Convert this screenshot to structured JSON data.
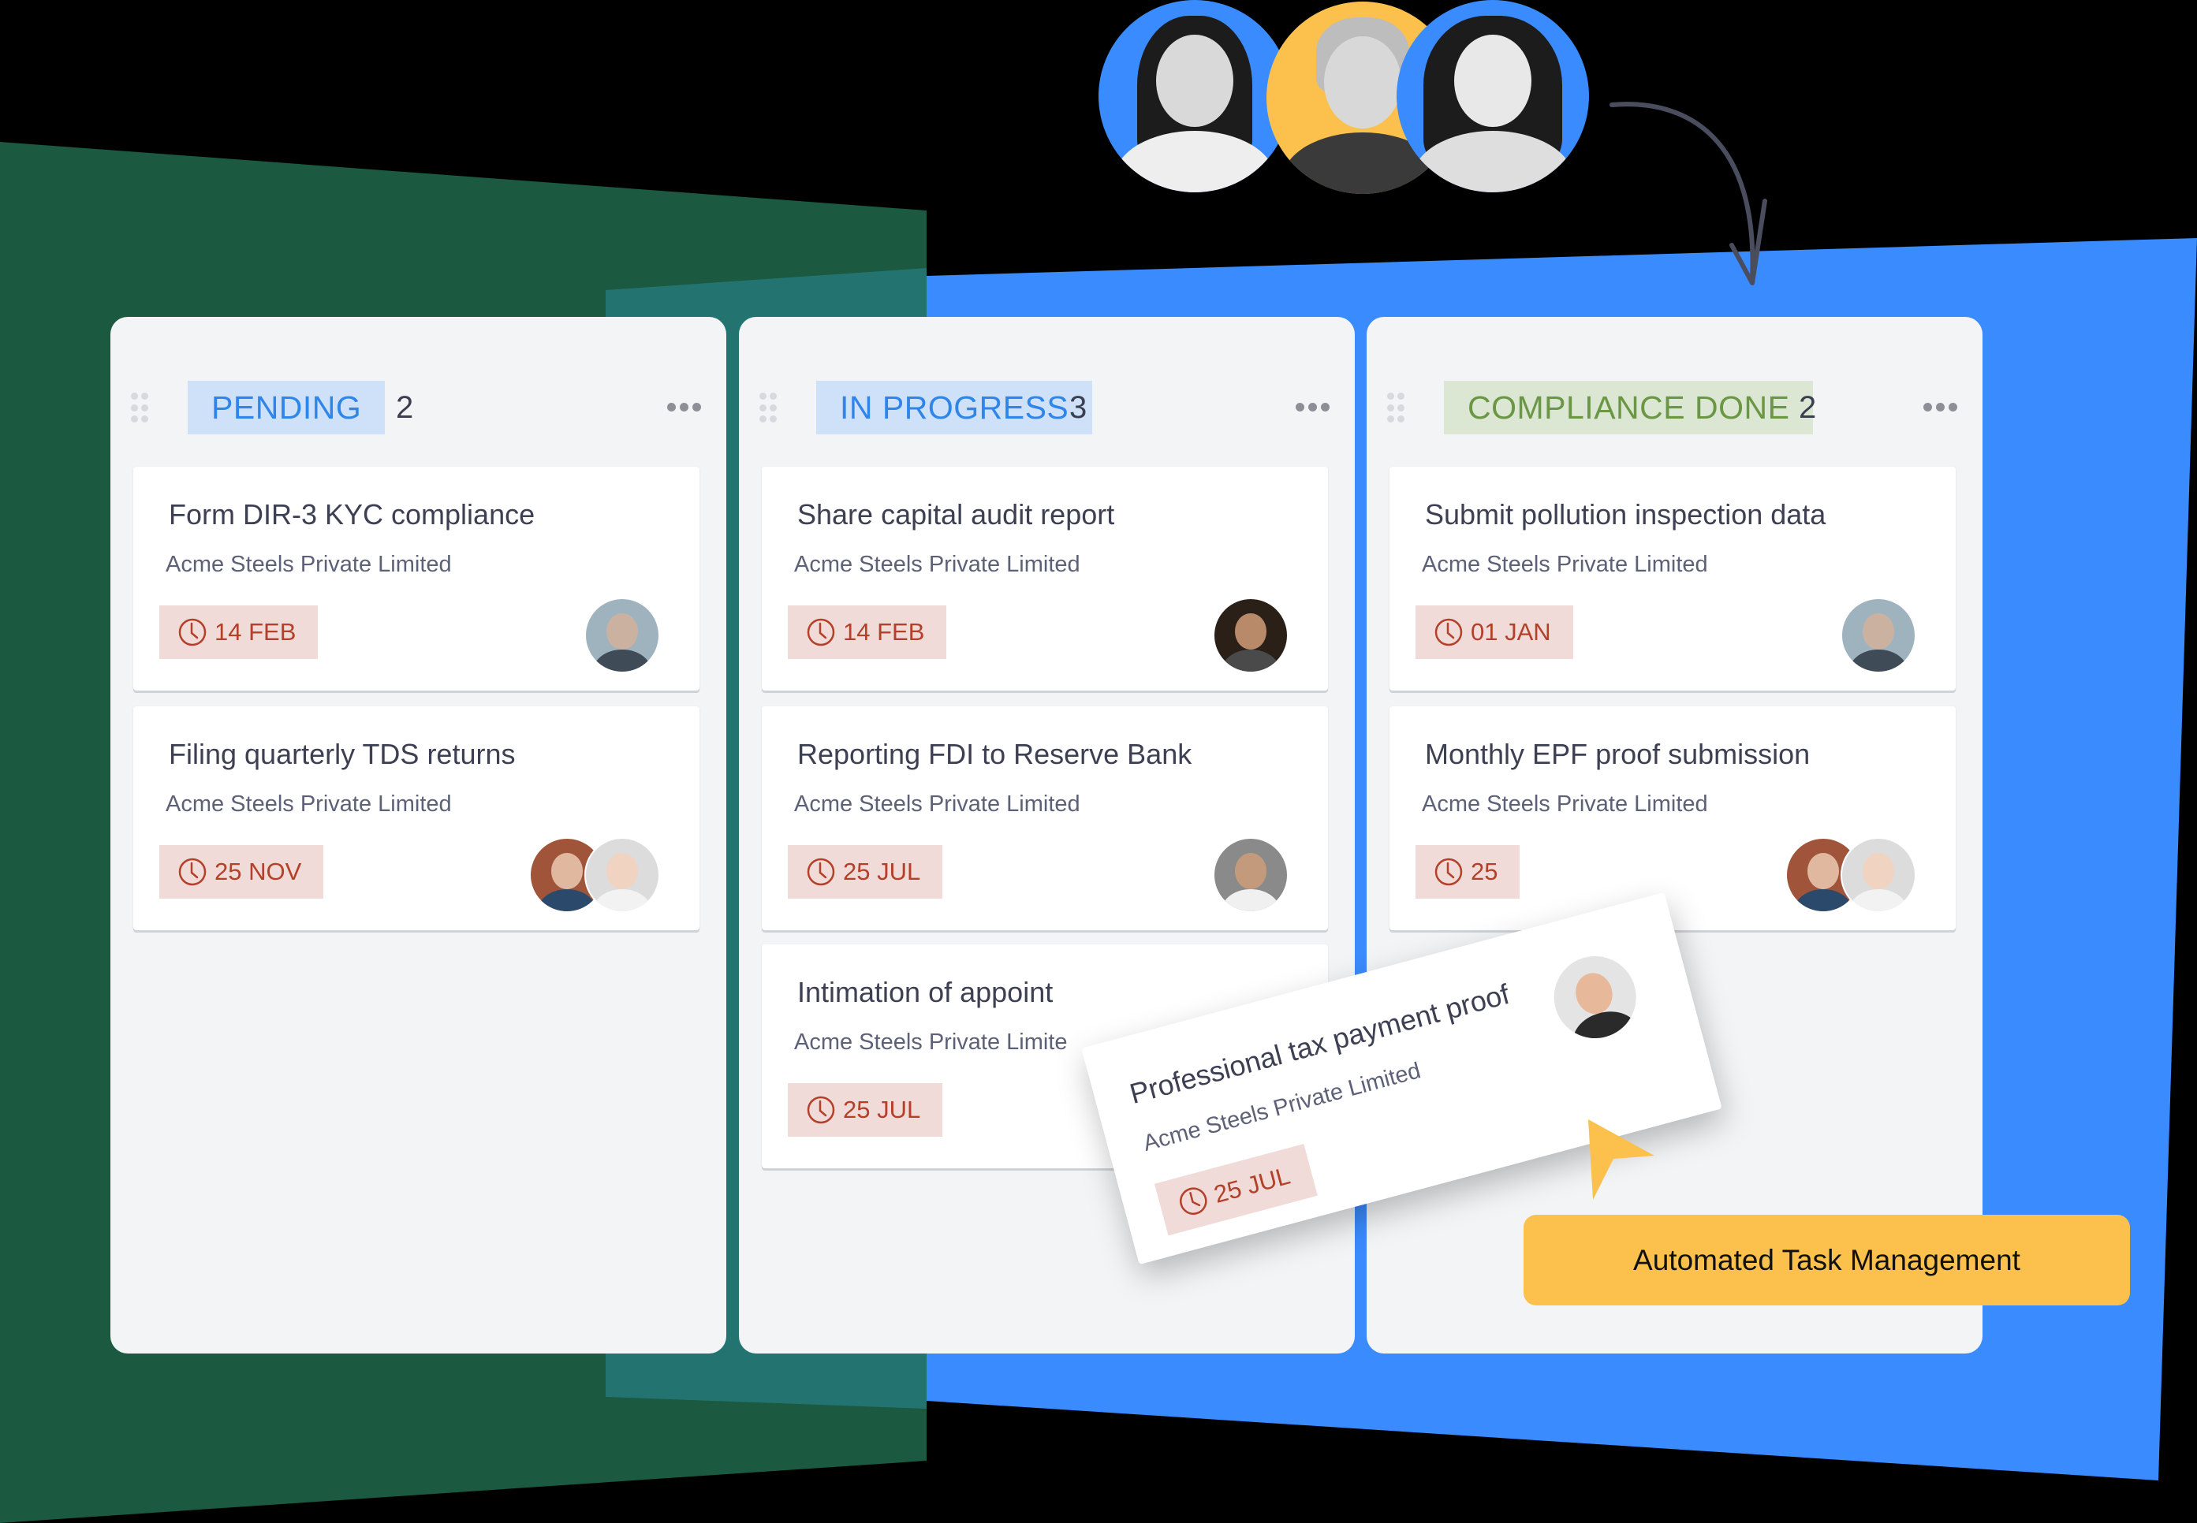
{
  "colors": {
    "background": "#000000",
    "green_shape": "#1b5940",
    "teal_overlap": "#237470",
    "blue_shape": "#3a8bfd",
    "column_bg": "#f2f4f6",
    "pill_blue_bg": "#cfe1f8",
    "pill_blue_text": "#2f86ea",
    "pill_green_bg": "#dbe6d3",
    "pill_green_text": "#6b9745",
    "date_chip_bg": "#f0dbd8",
    "date_chip_text": "#b4402a",
    "cta_bg": "#fcc14c",
    "team_blue": "#3a8bfd",
    "team_yellow": "#fcc14c"
  },
  "team_avatars": [
    {
      "name": "woman-long-hair-avatar",
      "ring": "blue"
    },
    {
      "name": "older-man-glasses-avatar",
      "ring": "yellow"
    },
    {
      "name": "woman-curly-hair-avatar",
      "ring": "blue"
    }
  ],
  "columns": [
    {
      "label": "PENDING",
      "count": "2",
      "style": "blue",
      "cards": [
        {
          "title": "Form DIR-3 KYC compliance",
          "company": "Acme Steels Private Limited",
          "due": "14 FEB",
          "assignees": [
            "older-man"
          ]
        },
        {
          "title": "Filing quarterly TDS returns",
          "company": "Acme Steels Private Limited",
          "due": "25 NOV",
          "assignees": [
            "short-hair-woman",
            "asian-woman"
          ]
        }
      ]
    },
    {
      "label": "IN PROGRESS",
      "count": "3",
      "style": "blue",
      "cards": [
        {
          "title": "Share capital audit report",
          "company": "Acme Steels Private Limited",
          "due": "14 FEB",
          "assignees": [
            "man-dark-hair"
          ]
        },
        {
          "title": "Reporting FDI to Reserve Bank",
          "company": "Acme Steels Private Limited",
          "due": "25 JUL",
          "assignees": [
            "man-dreadlocks"
          ]
        },
        {
          "title": "Intimation of appoint",
          "company": "Acme Steels Private Limite",
          "due": "25 JUL",
          "assignees": []
        }
      ]
    },
    {
      "label": "COMPLIANCE DONE",
      "count": "2",
      "style": "green",
      "cards": [
        {
          "title": "Submit pollution inspection data",
          "company": "Acme Steels Private Limited",
          "due": "01 JAN",
          "assignees": [
            "older-man"
          ]
        },
        {
          "title": "Monthly EPF proof submission",
          "company": "Acme Steels Private Limited",
          "due": "25",
          "assignees": [
            "short-hair-woman",
            "asian-woman"
          ]
        }
      ]
    }
  ],
  "dragged_card": {
    "title": "Professional tax payment proof",
    "company": "Acme Steels Private Limited",
    "due": "25 JUL",
    "assignees": [
      "man-sunglasses"
    ]
  },
  "cta": {
    "label": "Automated Task Management"
  }
}
